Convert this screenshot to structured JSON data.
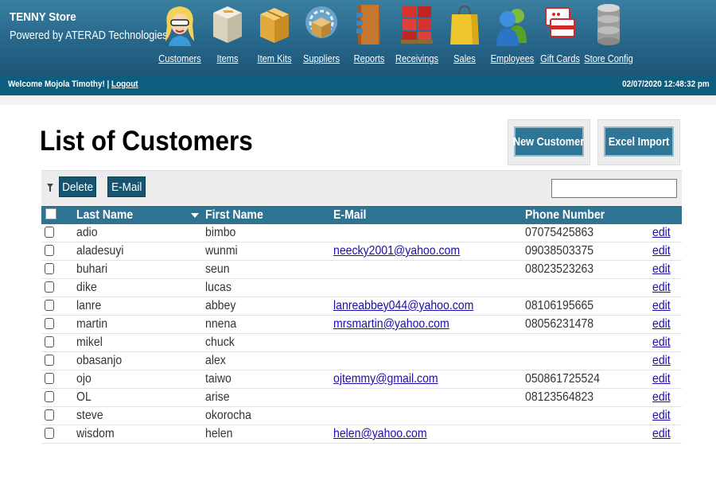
{
  "brand": {
    "title": "TENNY Store",
    "subtitle": "Powered by ATERAD Technologies"
  },
  "nav": [
    {
      "label": "Customers",
      "icon": "customers-icon"
    },
    {
      "label": "Items",
      "icon": "items-icon"
    },
    {
      "label": "Item Kits",
      "icon": "item-kits-icon"
    },
    {
      "label": "Suppliers",
      "icon": "suppliers-icon"
    },
    {
      "label": "Reports",
      "icon": "reports-icon"
    },
    {
      "label": "Receivings",
      "icon": "receivings-icon"
    },
    {
      "label": "Sales",
      "icon": "sales-icon"
    },
    {
      "label": "Employees",
      "icon": "employees-icon"
    },
    {
      "label": "Gift Cards",
      "icon": "gift-cards-icon"
    },
    {
      "label": "Store Config",
      "icon": "store-config-icon"
    }
  ],
  "welcome": {
    "text": "Welcome Mojola Timothy! |",
    "logout": "Logout",
    "datetime": "02/07/2020 12:48:32 pm"
  },
  "page": {
    "title": "List of Customers",
    "new_customer": "New Customer",
    "excel_import": "Excel Import"
  },
  "toolbar": {
    "delete": "Delete",
    "email": "E-Mail",
    "search_value": ""
  },
  "table": {
    "headers": {
      "last_name": "Last Name",
      "first_name": "First Name",
      "email": "E-Mail",
      "phone": "Phone Number"
    },
    "edit_label": "edit",
    "rows": [
      {
        "last": "adio",
        "first": "bimbo",
        "email": "",
        "phone": "07075425863"
      },
      {
        "last": "aladesuyi",
        "first": "wunmi",
        "email": "neecky2001@yahoo.com",
        "phone": "09038503375"
      },
      {
        "last": "buhari",
        "first": "seun",
        "email": "",
        "phone": "08023523263"
      },
      {
        "last": "dike",
        "first": "lucas",
        "email": "",
        "phone": ""
      },
      {
        "last": "lanre",
        "first": "abbey",
        "email": "lanreabbey044@yahoo.com",
        "phone": "08106195665"
      },
      {
        "last": "martin",
        "first": "nnena",
        "email": "mrsmartin@yahoo.com",
        "phone": "08056231478"
      },
      {
        "last": "mikel",
        "first": "chuck",
        "email": "",
        "phone": ""
      },
      {
        "last": "obasanjo",
        "first": "alex",
        "email": "",
        "phone": ""
      },
      {
        "last": "ojo",
        "first": "taiwo",
        "email": "ojtemmy@gmail.com",
        "phone": "050861725524"
      },
      {
        "last": "OL",
        "first": "arise",
        "email": "",
        "phone": "08123564823"
      },
      {
        "last": "steve",
        "first": "okorocha",
        "email": "",
        "phone": ""
      },
      {
        "last": "wisdom",
        "first": "helen",
        "email": "helen@yahoo.com",
        "phone": ""
      }
    ]
  }
}
